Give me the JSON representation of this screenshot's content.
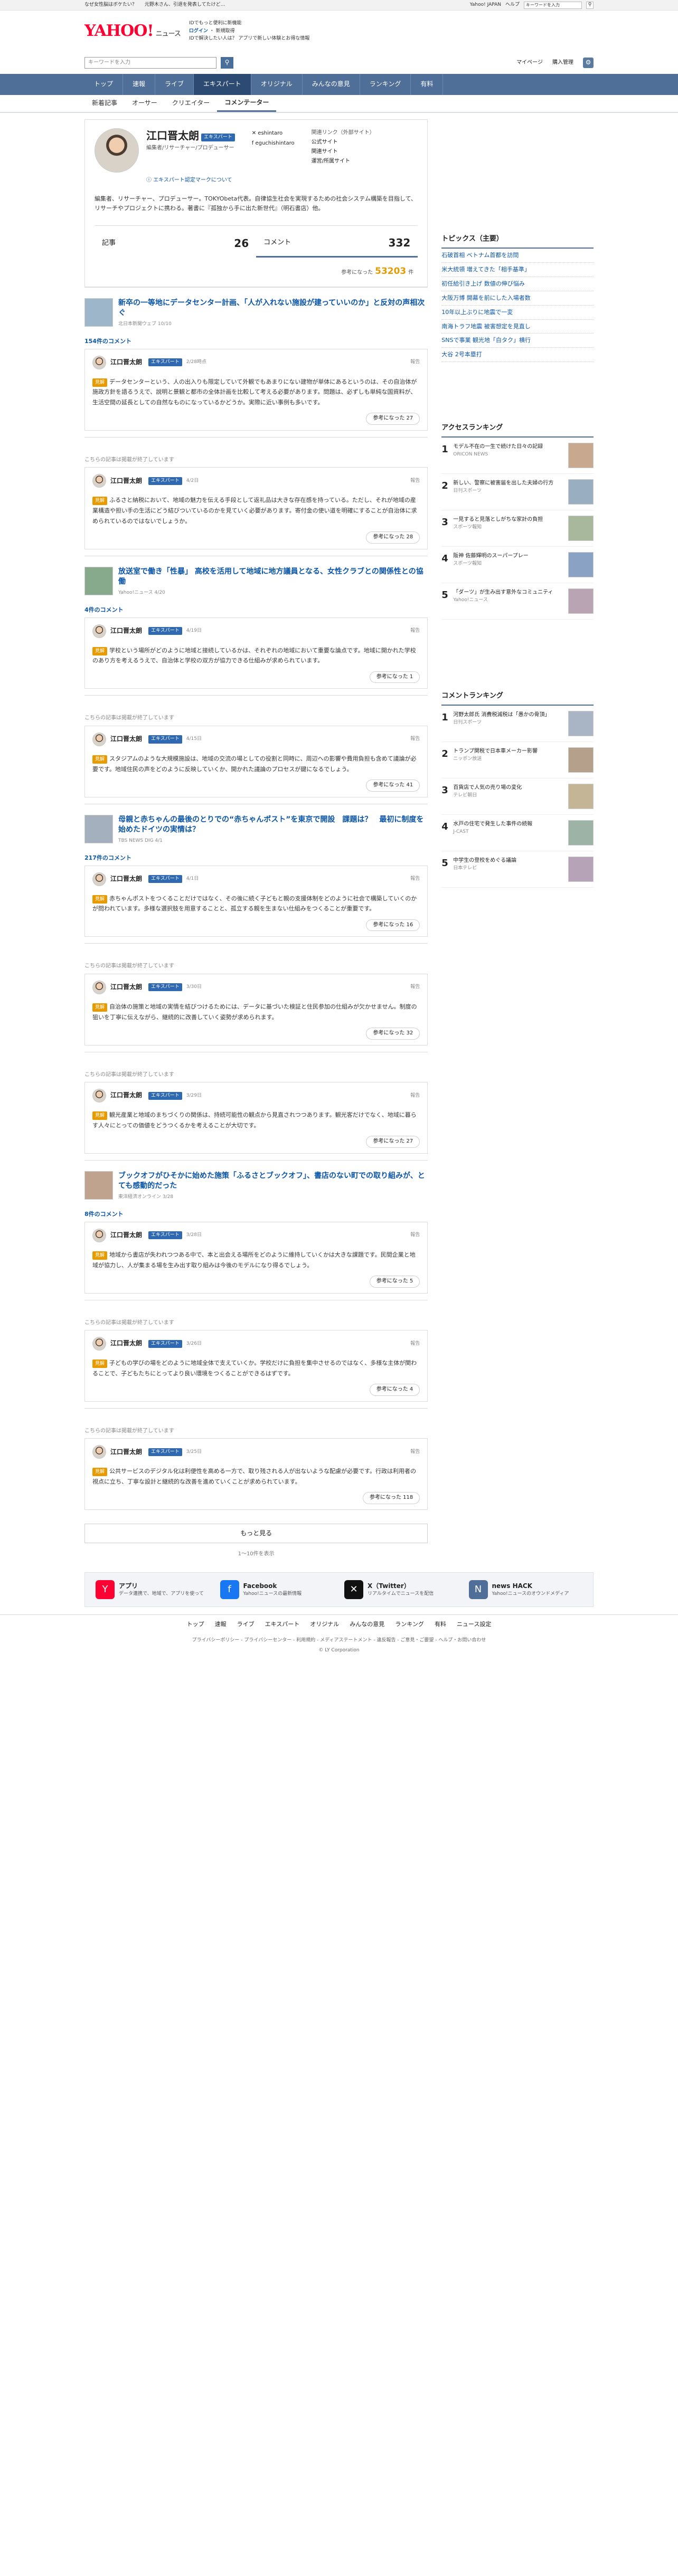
{
  "util": {
    "left": [
      "なぜ女性脳はボケたい？",
      "元野木さん、引退を発表してたけど…"
    ],
    "right": [
      "Yahoo! JAPAN",
      "ヘルプ"
    ],
    "search_placeholder": "キーワードを入力"
  },
  "header": {
    "logo_main": "YAHOO!",
    "logo_news": "ニュース",
    "logo_sub": "JAPAN",
    "line1": "IDでもっと便利に新機能",
    "line2": "ログイン",
    "line3": "新規取得",
    "line4": "IDで解決したい人は？ アプリで新しい体験とお得な情報"
  },
  "search": {
    "placeholder": "キーワードを入力",
    "mypage": "マイページ",
    "register": "購入管理"
  },
  "gnav": [
    "トップ",
    "速報",
    "ライブ",
    "エキスパート",
    "オリジナル",
    "みんなの意見",
    "ランキング",
    "有料"
  ],
  "subnav": [
    "新着記事",
    "オーサー",
    "クリエイター",
    "コメンテーター"
  ],
  "profile": {
    "name": "江口晋太朗",
    "badge": "エキスパート",
    "role": "編集者/リサーチャー/プロデューサー",
    "sns": [
      "eshintaro",
      "eguchishintaro"
    ],
    "links_title": "関連リンク（外部サイト）",
    "links": [
      "公式サイト",
      "関連サイト",
      "運営/所属サイト"
    ],
    "about": "エキスパート認定マークについて",
    "bio": "編集者、リサーチャー、プロデューサー。TOKYObeta代表。自律協生社会を実現するための社会システム構築を目指して、リサーチやプロジェクトに携わる。著書に『孤独から手に出た新世代』（明石書店）他。"
  },
  "stats": {
    "articles_label": "記事",
    "articles": "26",
    "comments_label": "コメント",
    "comments": "332"
  },
  "trust": {
    "label": "参考になった",
    "value": "53203",
    "unit": "件"
  },
  "entries": [
    {
      "title": "新卒の一等地にデータセンター計画、「人が入れない施設が建っていいのか」と反対の声相次ぐ",
      "meta": "北日本新聞ウェブ 10/10",
      "count": "154件のコメント",
      "date": "2/28時点",
      "tag": "見解",
      "text": "データセンターという、人の出入りも限定していて外観でもあまりにない建物が単体にあるというのは、その自治体が施政方針を語るうえで、説明と景観と都市の全体計画を比較して考える必要があります。問題は、必ずしも単純な国資料が、生活空間の延長としての自然なものになっているかどうか。実際に近い事例も多いです。",
      "helpful": "参考になった 27"
    },
    {
      "title": "",
      "meta": "",
      "count": "",
      "date": "4/2日",
      "tag": "見解",
      "text": "ふるさと納税において、地域の魅力を伝える手段として返礼品は大きな存在感を持っている。ただし、それが地域の産業構造や担い手の生活にどう結びついているのかを見ていく必要があります。寄付金の使い道を明確にすることが自治体に求められているのではないでしょうか。",
      "helpful": "参考になった 28"
    },
    {
      "title": "放送室で働き「性暴」 高校を活用して地域に地方議員となる、女性クラブとの関係性との協働",
      "meta": "Yahoo!ニュース 4/20",
      "count": "4件のコメント",
      "date": "4/19日",
      "tag": "見解",
      "text": "学校という場所がどのように地域と接続しているかは、それぞれの地域において重要な論点です。地域に開かれた学校のあり方を考えるうえで、自治体と学校の双方が協力できる仕組みが求められています。",
      "helpful": "参考になった 1"
    },
    {
      "title": "",
      "meta": "",
      "count": "",
      "date": "4/15日",
      "tag": "見解",
      "text": "スタジアムのような大規模施設は、地域の交流の場としての役割と同時に、周辺への影響や費用負担も含めて議論が必要です。地域住民の声をどのように反映していくか、開かれた議論のプロセスが鍵になるでしょう。",
      "helpful": "参考になった 41"
    },
    {
      "title": "母親と赤ちゃんの最後のとりでの“赤ちゃんポスト”を東京で開設　課題は？　最初に制度を始めたドイツの実情は？",
      "meta": "TBS NEWS DIG 4/1",
      "count": "217件のコメント",
      "date": "4/1日",
      "tag": "見解",
      "text": "赤ちゃんポストをつくることだけではなく、その後に続く子どもと親の支援体制をどのように社会で構築していくのかが問われています。多様な選択肢を用意することと、孤立する親を生まない仕組みをつくることが重要です。",
      "helpful": "参考になった 16"
    },
    {
      "title": "",
      "meta": "",
      "count": "",
      "date": "3/30日",
      "tag": "見解",
      "text": "自治体の施策と地域の実情を結びつけるためには、データに基づいた検証と住民参加の仕組みが欠かせません。制度の狙いを丁寧に伝えながら、継続的に改善していく姿勢が求められます。",
      "helpful": "参考になった 32"
    },
    {
      "title": "",
      "meta": "",
      "count": "",
      "date": "3/29日",
      "tag": "見解",
      "text": "観光産業と地域のまちづくりの関係は、持続可能性の観点から見直されつつあります。観光客だけでなく、地域に暮らす人々にとっての価値をどうつくるかを考えることが大切です。",
      "helpful": "参考になった 27"
    },
    {
      "title": "ブックオフがひそかに始めた施策「ふるさとブックオフ」、書店のない町での取り組みが、とても感動的だった",
      "meta": "東洋経済オンライン 3/28",
      "count": "8件のコメント",
      "date": "3/28日",
      "tag": "見解",
      "text": "地域から書店が失われつつある中で、本と出会える場所をどのように維持していくかは大きな課題です。民間企業と地域が協力し、人が集まる場を生み出す取り組みは今後のモデルになり得るでしょう。",
      "helpful": "参考になった 5"
    },
    {
      "title": "",
      "meta": "",
      "count": "",
      "date": "3/26日",
      "tag": "見解",
      "text": "子どもの学びの場をどのように地域全体で支えていくか。学校だけに負担を集中させるのではなく、多様な主体が関わることで、子どもたちにとってより良い環境をつくることができるはずです。",
      "helpful": "参考になった 4"
    },
    {
      "title": "",
      "meta": "",
      "count": "",
      "date": "3/25日",
      "tag": "見解",
      "text": "公共サービスのデジタル化は利便性を高める一方で、取り残される人が出ないような配慮が必要です。行政は利用者の視点に立ち、丁寧な設計と継続的な改善を進めていくことが求められています。",
      "helpful": "参考になった 118"
    }
  ],
  "closed_note": "こちらの記事は掲載が終了しています",
  "more": "もっと見る",
  "pageinfo": "1〜10件を表示",
  "right": {
    "topics_title": "トピックス（主要）",
    "topics": [
      "石破首相 ベトナム首都を訪問",
      "米大統領 増えてきた「相手基準」",
      "初任給引き上げ 数値の伸び悩み",
      "大阪万博 開幕を前にした入場者数",
      "10年以上ぶりに地震で一変",
      "南海トラフ地震 被害想定を見直し",
      "SNSで事業 観光地「白タク」横行",
      "大谷 2号本塁打"
    ],
    "access_title": "アクセスランキング",
    "access": [
      {
        "text": "モデル不在の一生で続けた日々の記録",
        "src": "ORICON NEWS"
      },
      {
        "text": "新しい、警察に被害届を出した夫婦の行方",
        "src": "日刊スポーツ"
      },
      {
        "text": "一見すると見落としがちな家計の負担",
        "src": "スポーツ報知"
      },
      {
        "text": "阪神 佐藤輝明のスーパープレー",
        "src": "スポーツ報知"
      },
      {
        "text": "「ダーツ」が生み出す意外なコミュニティ",
        "src": "Yahoo!ニュース"
      }
    ],
    "comment_title": "コメントランキング",
    "comment_rank": [
      {
        "text": "河野太郎氏 消費税減税は「愚かの骨頂」",
        "src": "日刊スポーツ"
      },
      {
        "text": "トランプ関税で日本車メーカー影響",
        "src": "ニッポン放送"
      },
      {
        "text": "百貨店で人気の売り場の変化",
        "src": "テレビ朝日"
      },
      {
        "text": "水戸の住宅で発生した事件の続報",
        "src": "J-CAST"
      },
      {
        "text": "中学生の登校をめぐる議論",
        "src": "日本テレビ"
      }
    ]
  },
  "footer": {
    "boxes": [
      {
        "title": "アプリ",
        "desc": "データ連携で、地域で、アプリを使って"
      },
      {
        "title": "Facebook",
        "desc": "Yahoo!ニュースの最新情報"
      },
      {
        "title": "X（Twitter）",
        "desc": "リアルタイムでニュースを配信"
      },
      {
        "title": "news HACK",
        "desc": "Yahoo!ニュースのオウンドメディア"
      }
    ],
    "nav": [
      "トップ",
      "速報",
      "ライブ",
      "エキスパート",
      "オリジナル",
      "みんなの意見",
      "ランキング",
      "有料",
      "ニュース設定"
    ],
    "legal": "プライバシーポリシー - プライバシーセンター - 利用規約 - メディアステートメント - 違反報告 - ご意見・ご要望 - ヘルプ・お問い合わせ",
    "copyright": "© LY Corporation"
  }
}
